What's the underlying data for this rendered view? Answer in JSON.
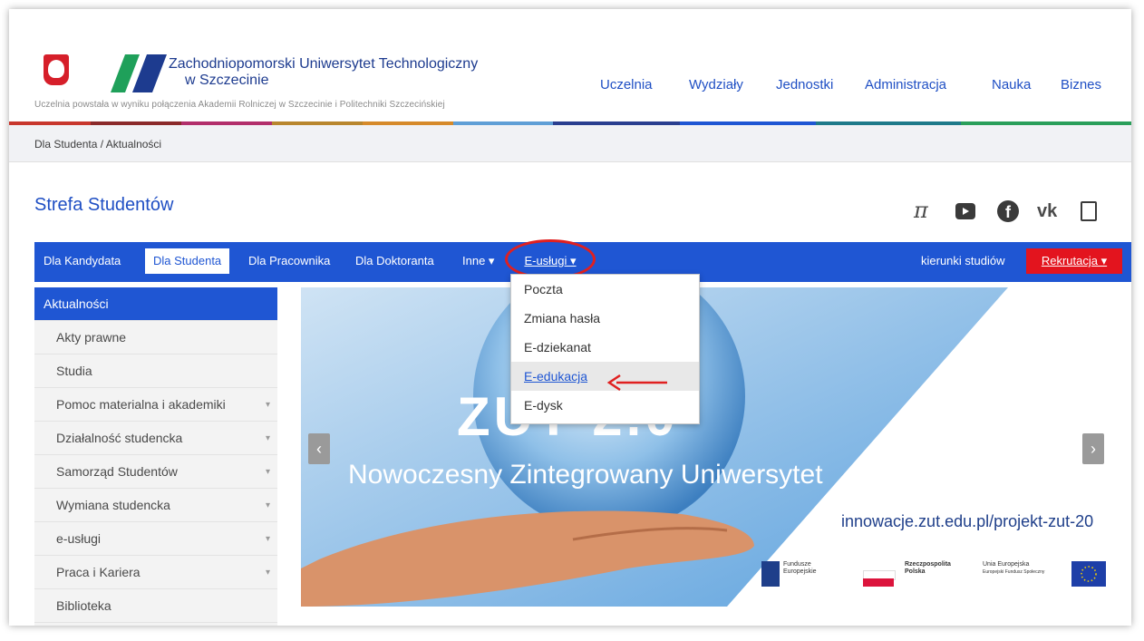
{
  "header": {
    "university_name_line1": "Zachodniopomorski Uniwersytet Technologiczny",
    "university_name_line2": "w Szczecinie",
    "subtitle": "Uczelnia powstała w wyniku połączenia Akademii Rolniczej w Szczecinie i Politechniki Szczecińskiej",
    "nav": [
      "Uczelnia",
      "Wydziały",
      "Jednostki",
      "Administracja",
      "Nauka",
      "Biznes"
    ],
    "stripe_colors": [
      "#c8372d",
      "#8b2a2a",
      "#b22f6b",
      "#d68a2a",
      "#5f9fd6",
      "#2a3f8f",
      "#1f7a8a",
      "#2a9f5a",
      "#1f56d3"
    ]
  },
  "breadcrumb": "Dla Studenta /  Aktualności",
  "zone_title": "Strefa Studentów",
  "social_icons": [
    "pi-icon",
    "youtube-icon",
    "facebook-icon",
    "vk-icon",
    "radio-icon"
  ],
  "mainnav": {
    "items": [
      "Dla Kandydata",
      "Dla Studenta",
      "Dla Pracownika",
      "Dla Doktoranta",
      "Inne ▾",
      "E-usługi ▾"
    ],
    "right_link": "kierunki studiów",
    "recruit": "Rekrutacja ▾",
    "accent": "#1f56d3",
    "recruit_color": "#e3141e"
  },
  "dropdown": [
    "Poczta",
    "Zmiana hasła",
    "E-dziekanat",
    "E-edukacja",
    "E-dysk"
  ],
  "sidebar": [
    "Aktualności",
    "Akty prawne",
    "Studia",
    "Pomoc materialna i akademiki",
    "Działalność studencka",
    "Samorząd Studentów",
    "Wymiana studencka",
    "e-usługi",
    "Praca i Kariera",
    "Biblioteka"
  ],
  "hero": {
    "big_text": "ZUT 2.0",
    "tagline": "Nowoczesny Zintegrowany Uniwersytet",
    "url": "innowacje.zut.edu.pl/projekt-zut-20",
    "logos": [
      {
        "title": "Fundusze",
        "sub": "Europejskie"
      },
      {
        "title": "Rzeczpospolita",
        "sub": "Polska"
      },
      {
        "title": "Unia Europejska",
        "sub": "Europejski Fundusz Społeczny"
      }
    ]
  }
}
